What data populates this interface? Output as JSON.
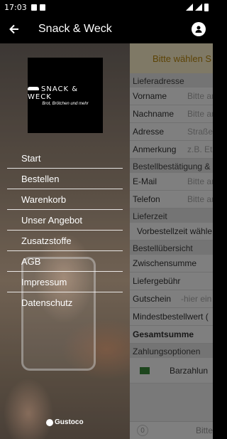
{
  "statusbar": {
    "time": "17:03"
  },
  "appbar": {
    "title": "Snack & Weck"
  },
  "logo": {
    "name": "SNACK & WECK",
    "tagline": "Brot, Brötchen und mehr"
  },
  "menu": {
    "items": [
      {
        "label": "Start"
      },
      {
        "label": "Bestellen"
      },
      {
        "label": "Warenkorb"
      },
      {
        "label": "Unser Angebot"
      },
      {
        "label": "Zusatzstoffe"
      },
      {
        "label": "AGB"
      },
      {
        "label": "Impressum"
      },
      {
        "label": "Datenschutz"
      }
    ]
  },
  "footer": {
    "brand": "Gustoco"
  },
  "form": {
    "banner": "Bitte wählen S",
    "delivery_header": "Lieferadresse",
    "vorname": {
      "label": "Vorname",
      "placeholder": "Bitte an"
    },
    "nachname": {
      "label": "Nachname",
      "placeholder": "Bitte an"
    },
    "adresse": {
      "label": "Adresse",
      "placeholder": "Straße"
    },
    "anmerkung": {
      "label": "Anmerkung",
      "placeholder": "z.B. Eta"
    },
    "confirm_header": "Bestellbestätigung &",
    "email": {
      "label": "E-Mail",
      "placeholder": "Bitte an"
    },
    "telefon": {
      "label": "Telefon",
      "placeholder": "Bitte an"
    },
    "lieferzeit_header": "Lieferzeit",
    "lieferzeit_value": "Vorbestellzeit wähle",
    "overview_header": "Bestellübersicht",
    "zwischensumme": "Zwischensumme",
    "liefergebuehr": "Liefergebühr",
    "gutschein": {
      "label": "Gutschein",
      "placeholder": "-hier ein"
    },
    "mindestbestellwert": "Mindestbestellwert (",
    "gesamtsumme": "Gesamtsumme",
    "payment_header": "Zahlungsoptionen",
    "barzahlung": "Barzahlun",
    "cart_count": "0",
    "bottom_label": "Bitte"
  }
}
